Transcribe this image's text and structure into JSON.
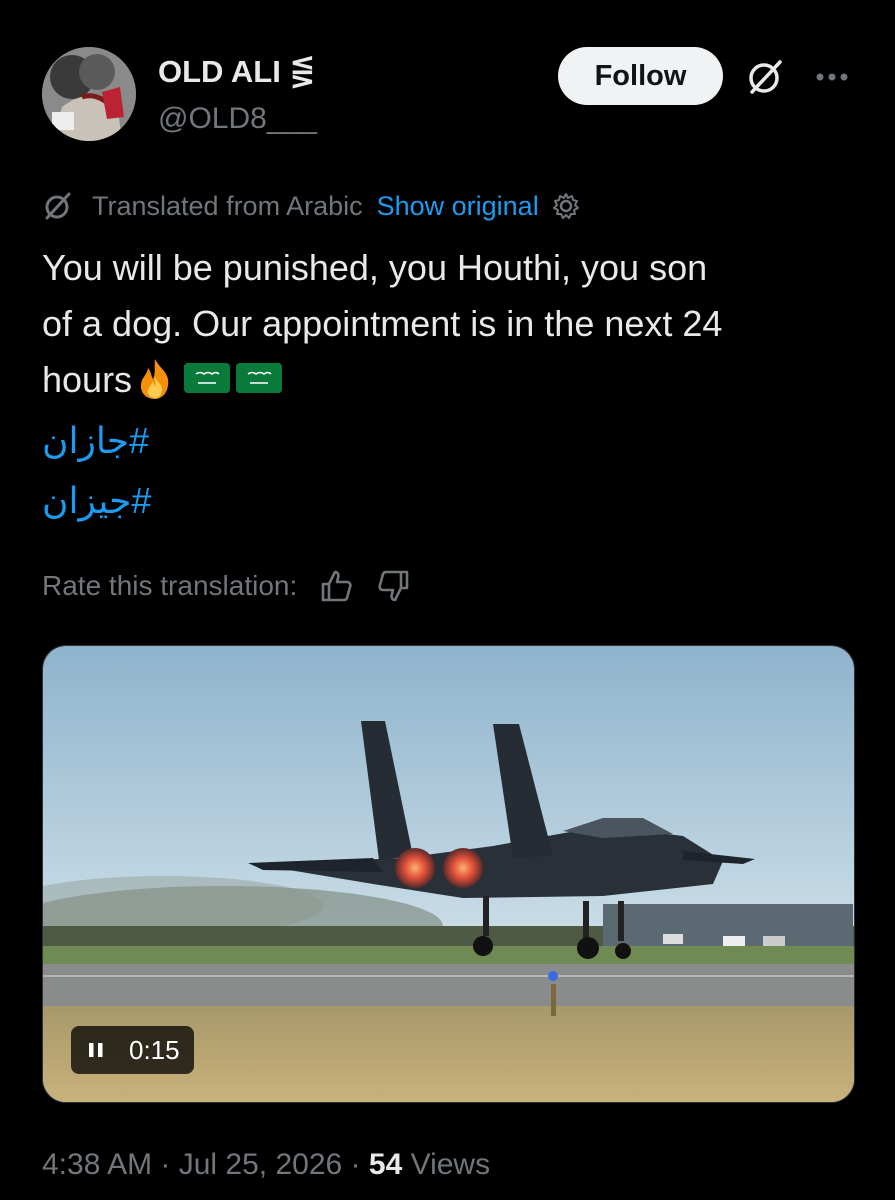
{
  "user": {
    "display_name": "OLD ALI ⋚",
    "handle": "@OLD8___"
  },
  "header": {
    "follow_label": "Follow",
    "grok_icon": "grok-icon",
    "more_icon": "more-icon"
  },
  "translation": {
    "label": "Translated from Arabic",
    "show_original": "Show original",
    "rate_label": "Rate this translation:"
  },
  "tweet": {
    "text_line1": "You will be punished, you Houthi, you son",
    "text_line2": "of a dog. Our appointment is in the next 24",
    "text_line3": "hours",
    "hashtag1": "#جازان",
    "hashtag2": "#جيزان"
  },
  "video": {
    "duration": "0:15"
  },
  "meta": {
    "time": "4:38 AM",
    "sep1": " · ",
    "date": "Jul 25, 2026",
    "sep2": " · ",
    "views_count": "54",
    "views_label": " Views"
  },
  "colors": {
    "background": "#000000",
    "text": "#e7e9ea",
    "muted": "#71767b",
    "link": "#1d9bf0"
  }
}
